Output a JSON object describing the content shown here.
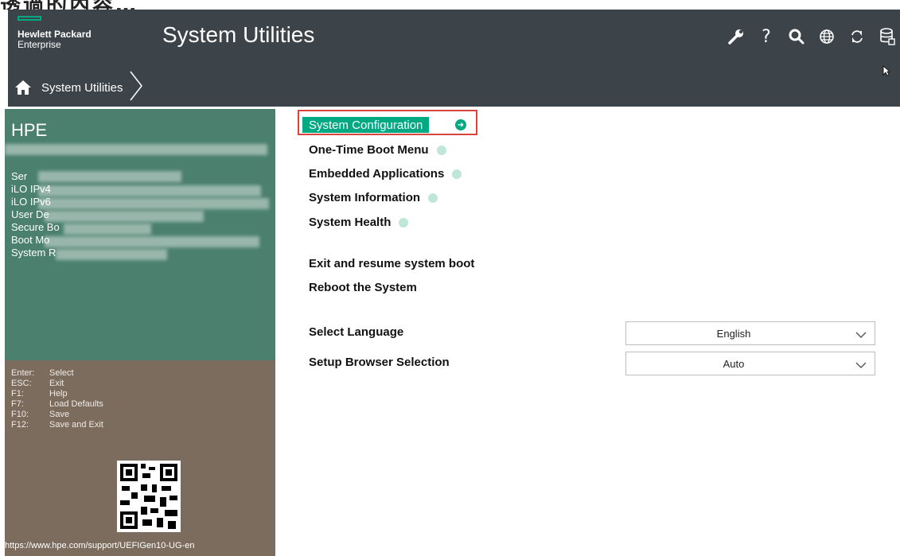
{
  "header": {
    "brand_line1": "Hewlett Packard",
    "brand_line2": "Enterprise",
    "title": "System Utilities",
    "breadcrumb_label": "System Utilities",
    "tool_icons": [
      "wrench-icon",
      "help-icon",
      "search-icon",
      "globe-icon",
      "refresh-icon",
      "database-icon"
    ],
    "colors": {
      "header_bg": "#3d4449",
      "brand_green": "#01a982"
    }
  },
  "left_panel": {
    "title": "HPE",
    "info_lines": [
      "Ser",
      "iLO IPv4",
      "iLO IPv6",
      "User De",
      "Secure Bo",
      "Boot Mo",
      "System R"
    ],
    "colors": {
      "panel_bg": "#4b7f6e",
      "keys_bg": "#7b6c5e"
    }
  },
  "keys": [
    {
      "key": "Enter:",
      "action": "Select"
    },
    {
      "key": "ESC:",
      "action": "Exit"
    },
    {
      "key": "F1:",
      "action": "Help"
    },
    {
      "key": "F7:",
      "action": "Load Defaults"
    },
    {
      "key": "F10:",
      "action": "Save"
    },
    {
      "key": "F12:",
      "action": "Save and Exit"
    }
  ],
  "support_url": "https://www.hpe.com/support/UEFIGen10-UG-en",
  "menu": {
    "selected": "System Configuration",
    "items": [
      "One-Time Boot Menu",
      "Embedded Applications",
      "System Information",
      "System Health"
    ],
    "actions": [
      "Exit and resume system boot",
      "Reboot the System"
    ]
  },
  "settings": {
    "language_label": "Select Language",
    "language_value": "English",
    "browser_label": "Setup Browser Selection",
    "browser_value": "Auto"
  }
}
